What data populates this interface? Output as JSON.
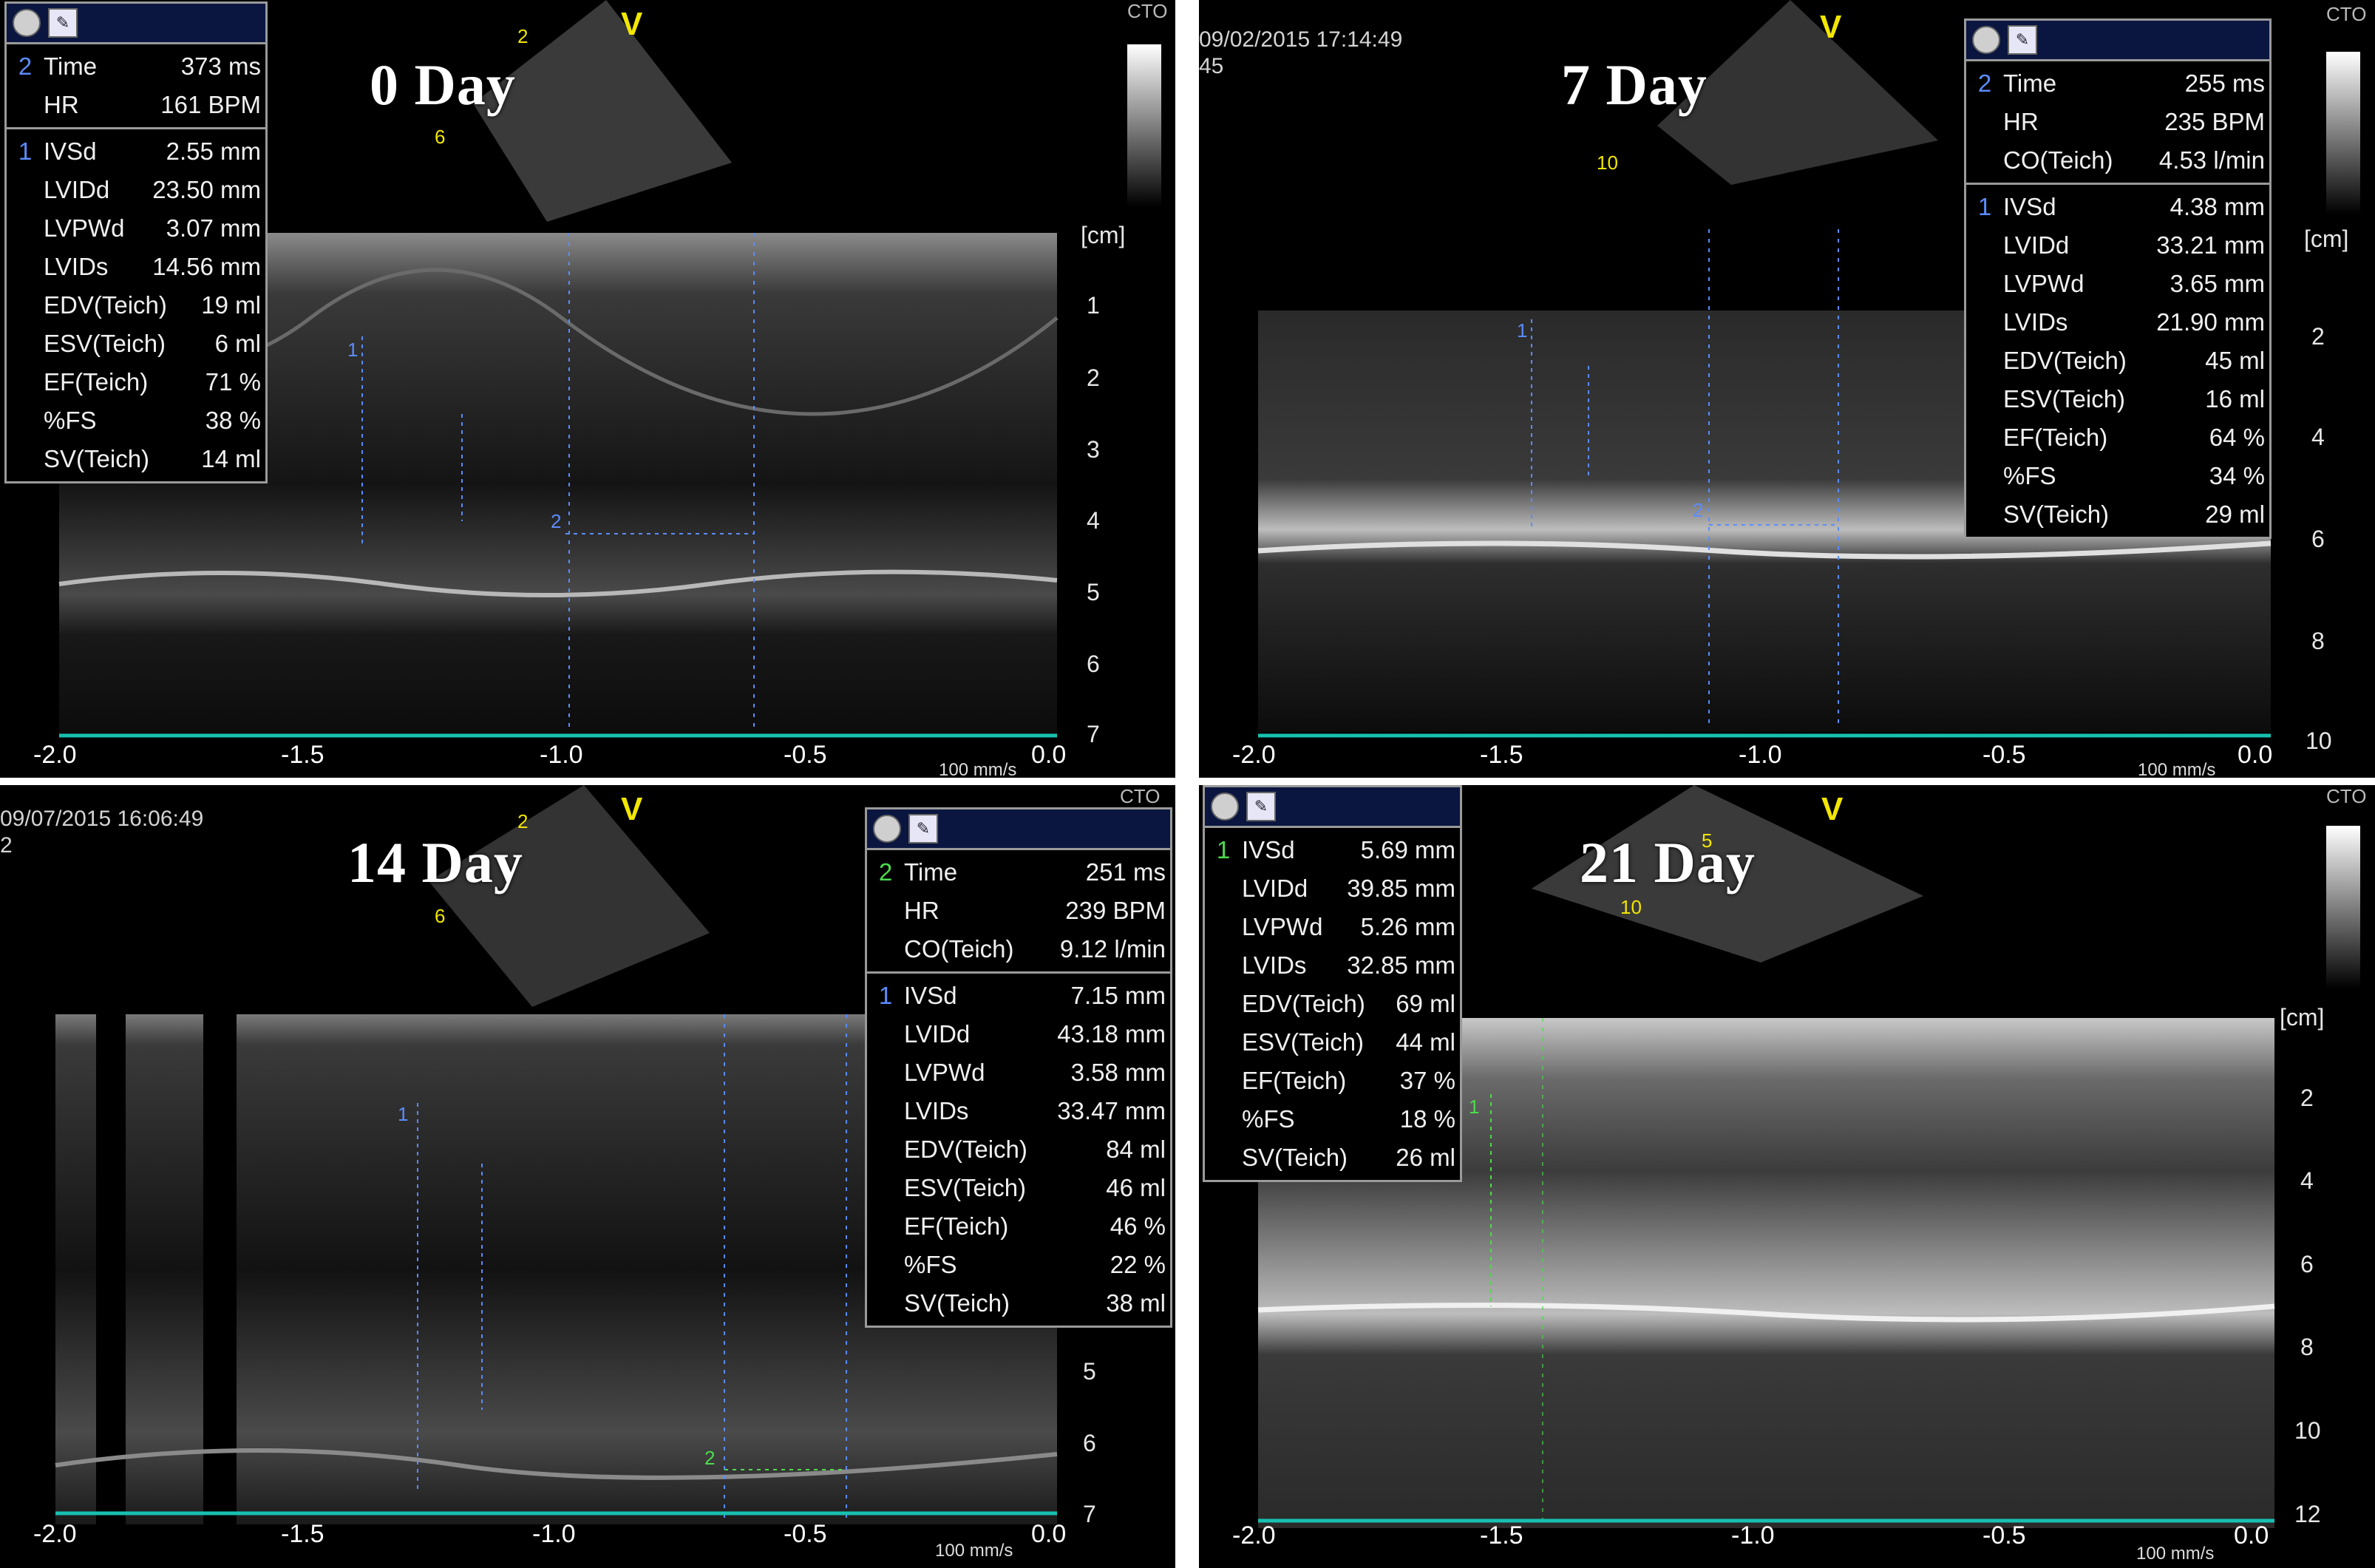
{
  "colors": {
    "measure_blue": "#5b8cff",
    "measure_green": "#4cdc4c",
    "baseline": "#17c0b0",
    "marker_yellow": "#f2e600",
    "panel_bg": "#000000"
  },
  "panels": [
    {
      "title": "0 Day",
      "stamp_date": "",
      "stamp_id": "",
      "cto": "CTO",
      "v_mark": "V",
      "speed": "100 mm/s",
      "depth_unit": "[cm]",
      "depth_labels": [
        "1",
        "2",
        "3",
        "4",
        "5",
        "6",
        "7"
      ],
      "time_ticks": [
        "-2.0",
        "-1.5",
        "-1.0",
        "-0.5",
        "0.0"
      ],
      "sector_marks": [
        "2",
        "6"
      ],
      "caliper_marks": [
        "1",
        "2"
      ],
      "measurements": {
        "header_icons": [
          "record-icon",
          "cursor-icon"
        ],
        "groups": [
          {
            "num": "2",
            "color": "blue",
            "rows": [
              {
                "label": "Time",
                "value": "373 ms"
              },
              {
                "label": "HR",
                "value": "161 BPM"
              }
            ]
          },
          {
            "num": "1",
            "color": "blue",
            "rows": [
              {
                "label": "IVSd",
                "value": "2.55 mm"
              },
              {
                "label": "LVIDd",
                "value": "23.50 mm"
              },
              {
                "label": "LVPWd",
                "value": "3.07 mm"
              },
              {
                "label": "LVIDs",
                "value": "14.56 mm"
              },
              {
                "label": "EDV(Teich)",
                "value": "19 ml"
              },
              {
                "label": "ESV(Teich)",
                "value": "6 ml"
              },
              {
                "label": "EF(Teich)",
                "value": "71 %"
              },
              {
                "label": "%FS",
                "value": "38 %"
              },
              {
                "label": "SV(Teich)",
                "value": "14 ml"
              }
            ]
          }
        ]
      }
    },
    {
      "title": "7 Day",
      "stamp_date": "09/02/2015 17:14:49",
      "stamp_id": "45",
      "cto": "CTO",
      "v_mark": "V",
      "speed": "100 mm/s",
      "depth_unit": "[cm]",
      "depth_labels": [
        "2",
        "4",
        "6",
        "8",
        "10"
      ],
      "time_ticks": [
        "-2.0",
        "-1.5",
        "-1.0",
        "-0.5",
        "0.0"
      ],
      "sector_marks": [
        "10"
      ],
      "caliper_marks": [
        "1",
        "2"
      ],
      "measurements": {
        "header_icons": [
          "record-icon",
          "cursor-icon"
        ],
        "groups": [
          {
            "num": "2",
            "color": "blue",
            "rows": [
              {
                "label": "Time",
                "value": "255 ms"
              },
              {
                "label": "HR",
                "value": "235 BPM"
              },
              {
                "label": "CO(Teich)",
                "value": "4.53 l/min"
              }
            ]
          },
          {
            "num": "1",
            "color": "blue",
            "rows": [
              {
                "label": "IVSd",
                "value": "4.38 mm"
              },
              {
                "label": "LVIDd",
                "value": "33.21 mm"
              },
              {
                "label": "LVPWd",
                "value": "3.65 mm"
              },
              {
                "label": "LVIDs",
                "value": "21.90 mm"
              },
              {
                "label": "EDV(Teich)",
                "value": "45 ml"
              },
              {
                "label": "ESV(Teich)",
                "value": "16 ml"
              },
              {
                "label": "EF(Teich)",
                "value": "64 %"
              },
              {
                "label": "%FS",
                "value": "34 %"
              },
              {
                "label": "SV(Teich)",
                "value": "29 ml"
              }
            ]
          }
        ]
      }
    },
    {
      "title": "14 Day",
      "stamp_date": "09/07/2015 16:06:49",
      "stamp_id": "2",
      "cto": "CTO",
      "v_mark": "V",
      "speed": "100 mm/s",
      "depth_unit": "",
      "depth_labels": [
        "5",
        "6",
        "7"
      ],
      "time_ticks": [
        "-2.0",
        "-1.5",
        "-1.0",
        "-0.5",
        "0.0"
      ],
      "sector_marks": [
        "2",
        "6"
      ],
      "caliper_marks": [
        "1",
        "2"
      ],
      "measurements": {
        "header_icons": [
          "record-icon",
          "cursor-icon"
        ],
        "groups": [
          {
            "num": "2",
            "color": "green",
            "rows": [
              {
                "label": "Time",
                "value": "251 ms"
              },
              {
                "label": "HR",
                "value": "239 BPM"
              },
              {
                "label": "CO(Teich)",
                "value": "9.12 l/min"
              }
            ]
          },
          {
            "num": "1",
            "color": "blue",
            "rows": [
              {
                "label": "IVSd",
                "value": "7.15 mm"
              },
              {
                "label": "LVIDd",
                "value": "43.18 mm"
              },
              {
                "label": "LVPWd",
                "value": "3.58 mm"
              },
              {
                "label": "LVIDs",
                "value": "33.47 mm"
              },
              {
                "label": "EDV(Teich)",
                "value": "84 ml"
              },
              {
                "label": "ESV(Teich)",
                "value": "46 ml"
              },
              {
                "label": "EF(Teich)",
                "value": "46 %"
              },
              {
                "label": "%FS",
                "value": "22 %"
              },
              {
                "label": "SV(Teich)",
                "value": "38 ml"
              }
            ]
          }
        ]
      }
    },
    {
      "title": "21 Day",
      "stamp_date": "",
      "stamp_id": "",
      "cto": "CTO",
      "v_mark": "V",
      "speed": "100 mm/s",
      "depth_unit": "[cm]",
      "depth_labels": [
        "2",
        "4",
        "6",
        "8",
        "10",
        "12"
      ],
      "time_ticks": [
        "-2.0",
        "-1.5",
        "-1.0",
        "-0.5",
        "0.0"
      ],
      "sector_marks": [
        "5",
        "10"
      ],
      "caliper_marks": [
        "1"
      ],
      "measurements": {
        "header_icons": [
          "record-icon",
          "cursor-icon"
        ],
        "groups": [
          {
            "num": "1",
            "color": "green",
            "rows": [
              {
                "label": "IVSd",
                "value": "5.69 mm"
              },
              {
                "label": "LVIDd",
                "value": "39.85 mm"
              },
              {
                "label": "LVPWd",
                "value": "5.26 mm"
              },
              {
                "label": "LVIDs",
                "value": "32.85 mm"
              },
              {
                "label": "EDV(Teich)",
                "value": "69 ml"
              },
              {
                "label": "ESV(Teich)",
                "value": "44 ml"
              },
              {
                "label": "EF(Teich)",
                "value": "37 %"
              },
              {
                "label": "%FS",
                "value": "18 %"
              },
              {
                "label": "SV(Teich)",
                "value": "26 ml"
              }
            ]
          }
        ]
      }
    }
  ]
}
